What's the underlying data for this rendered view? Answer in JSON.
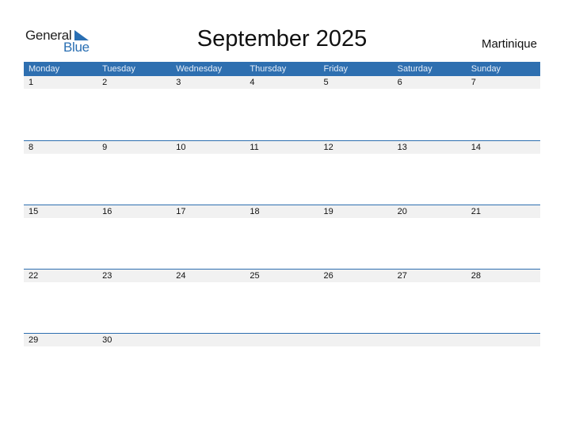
{
  "logo": {
    "word1": "General",
    "word2": "Blue"
  },
  "title": "September 2025",
  "region": "Martinique",
  "colors": {
    "accent": "#2e6fb0",
    "strip": "#f1f1f1"
  },
  "weekdays": [
    "Monday",
    "Tuesday",
    "Wednesday",
    "Thursday",
    "Friday",
    "Saturday",
    "Sunday"
  ],
  "weeks": [
    [
      "1",
      "2",
      "3",
      "4",
      "5",
      "6",
      "7"
    ],
    [
      "8",
      "9",
      "10",
      "11",
      "12",
      "13",
      "14"
    ],
    [
      "15",
      "16",
      "17",
      "18",
      "19",
      "20",
      "21"
    ],
    [
      "22",
      "23",
      "24",
      "25",
      "26",
      "27",
      "28"
    ],
    [
      "29",
      "30",
      "",
      "",
      "",
      "",
      ""
    ]
  ]
}
